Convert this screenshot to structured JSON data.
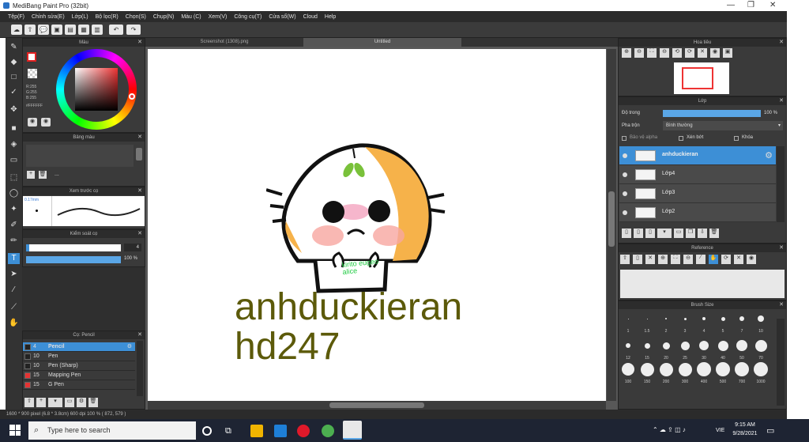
{
  "window": {
    "title": "MediBang Paint Pro (32bit)"
  },
  "menu": [
    "Tệp(F)",
    "Chỉnh sửa(E)",
    "Lớp(L)",
    "Bộ lọc(R)",
    "Chọn(S)",
    "Chụp(N)",
    "Màu (C)",
    "Xem(V)",
    "Công cụ(T)",
    "Cửa sổ(W)",
    "Cloud",
    "Help"
  ],
  "doc_tabs": [
    "Screenshot (1308).png",
    "Untitled"
  ],
  "color_panel": {
    "title": "Màu",
    "r": "R:255",
    "g": "G:255",
    "b": "B:255",
    "hex": "#FFFFFF"
  },
  "palette_panel": {
    "title": "Bảng màu",
    "dots": "..."
  },
  "brush_preview": {
    "title": "Xem trước cọ",
    "size": "0.17mm"
  },
  "brush_control": {
    "title": "Kiểm soát cọ",
    "size": "4",
    "opacity": "100 %"
  },
  "brush_list": {
    "title": "Cọ: Pencil",
    "items": [
      {
        "size": "4",
        "name": "Pencil",
        "color": "#222"
      },
      {
        "size": "10",
        "name": "Pen",
        "color": "#222"
      },
      {
        "size": "10",
        "name": "Pen (Sharp)",
        "color": "#222"
      },
      {
        "size": "15",
        "name": "Mapping Pen",
        "color": "#e53333"
      },
      {
        "size": "15",
        "name": "G Pen",
        "color": "#e53333"
      }
    ]
  },
  "navigator": {
    "title": "Hoa tiêu"
  },
  "layer_panel": {
    "title": "Lớp",
    "opacity_label": "Độ trong",
    "opacity_value": "100 %",
    "blend_label": "Pha trộn",
    "blend_value": "Bình thường",
    "protect_alpha": "Bảo vệ alpha",
    "clipping": "Xén bớt",
    "lock": "Khóa",
    "layers": [
      "anhduckieran",
      "Lớp4",
      "Lớp3",
      "Lớp2"
    ]
  },
  "reference_panel": {
    "title": "Reference"
  },
  "brush_size_panel": {
    "title": "Brush Size",
    "row1": [
      "1",
      "1.5",
      "2",
      "3",
      "4",
      "5",
      "7",
      "10"
    ],
    "row2": [
      "12",
      "15",
      "20",
      "25",
      "30",
      "40",
      "50",
      "70"
    ],
    "row3": [
      "100",
      "150",
      "200",
      "300",
      "400",
      "500",
      "700",
      "1000"
    ]
  },
  "canvas": {
    "text_line1": "anhduckieran",
    "text_line2": "hd247",
    "sticker_text": "kirito eugeo alice",
    "text_color": "#5c5a0a"
  },
  "status": {
    "text": "1600 * 900 pixel   (6.8 * 3.8cm)   600 dpi   100 %   ( 872, 579 )"
  },
  "taskbar": {
    "search_placeholder": "Type here to search",
    "lang": "VIE",
    "time": "9:15 AM",
    "date": "9/28/2021"
  }
}
